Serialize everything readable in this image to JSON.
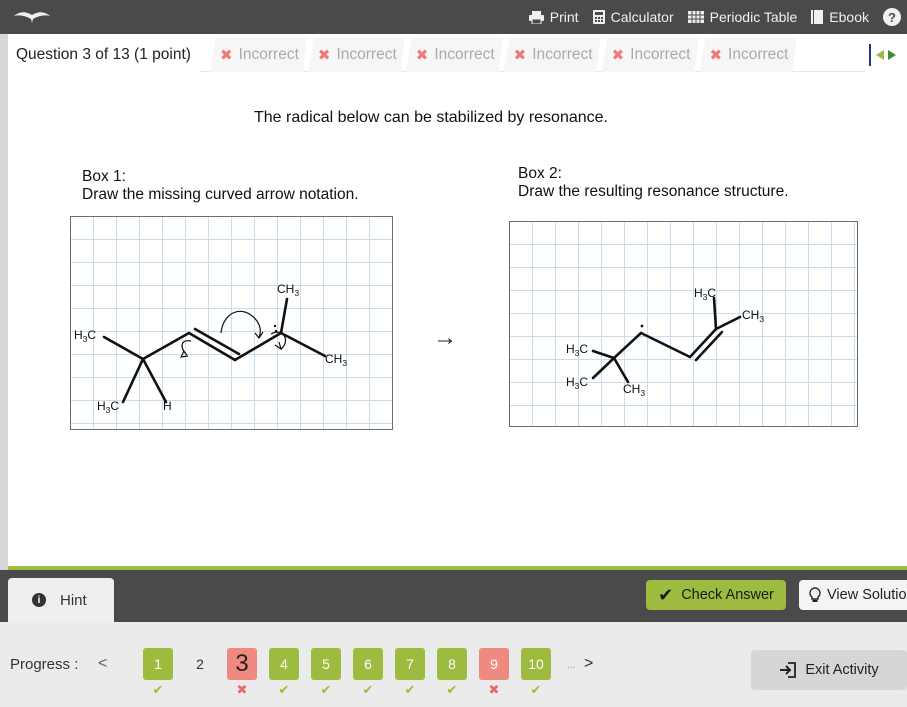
{
  "toolbar": {
    "print": "Print",
    "calculator": "Calculator",
    "periodic_table": "Periodic Table",
    "ebook": "Ebook",
    "help": "?"
  },
  "tabs": {
    "current": "Question 3 of 13 (1 point)",
    "history": [
      "Incorrect",
      "Incorrect",
      "Incorrect",
      "Incorrect",
      "Incorrect",
      "Incorrect"
    ]
  },
  "question": {
    "prompt": "The radical below can be stabilized by resonance.",
    "box1_label": "Box 1:",
    "box1_instruction": "Draw the missing curved arrow notation.",
    "box2_label": "Box 2:",
    "box2_instruction": "Draw the resulting resonance structure.",
    "arrow": "→",
    "box1_atoms": {
      "h3c_left": "H",
      "h3c_bottom": "H",
      "h_bottom": "H",
      "ch3_top": "CH",
      "ch3_right": "CH",
      "c": "C",
      "sub3": "3"
    },
    "box2_atoms": {
      "h3c_top": "H",
      "ch3_topright": "CH",
      "h3c_mid": "H",
      "h3c_low": "H",
      "ch3_low": "CH",
      "c": "C",
      "sub3": "3"
    }
  },
  "footer": {
    "hint": "Hint",
    "check_answer": "Check Answer",
    "view_solution": "View Solution",
    "progress_label": "Progress :",
    "prev": "<",
    "next": ">",
    "more": "...",
    "exit": "Exit Activity"
  },
  "progress": [
    {
      "label": "1",
      "status": "correct",
      "mark": "✔"
    },
    {
      "label": "2",
      "status": "plain",
      "mark": ""
    },
    {
      "label": "3",
      "status": "wrong-current",
      "mark": "✖"
    },
    {
      "label": "4",
      "status": "correct",
      "mark": "✔"
    },
    {
      "label": "5",
      "status": "correct",
      "mark": "✔"
    },
    {
      "label": "6",
      "status": "correct",
      "mark": "✔"
    },
    {
      "label": "7",
      "status": "correct",
      "mark": "✔"
    },
    {
      "label": "8",
      "status": "correct",
      "mark": "✔"
    },
    {
      "label": "9",
      "status": "wrong",
      "mark": "✖"
    },
    {
      "label": "10",
      "status": "correct",
      "mark": "✔"
    }
  ],
  "colors": {
    "toolbar_bg": "#4a4a4a",
    "accent_green": "#9dbb3f",
    "incorrect_red": "#ee7b7b",
    "grid_blue": "#c7dcef"
  }
}
